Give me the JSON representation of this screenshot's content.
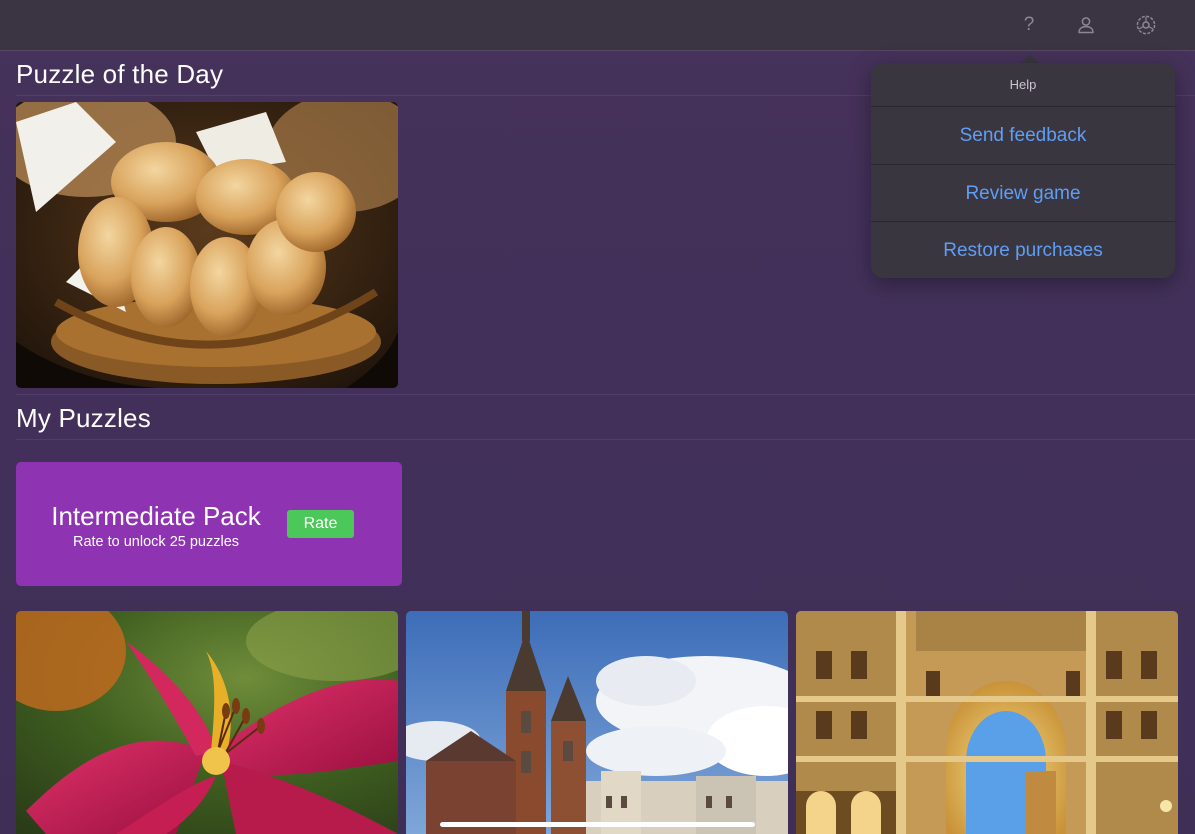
{
  "toolbar": {
    "help_glyph": "?",
    "icons": [
      "help-icon",
      "person-icon",
      "gear-icon"
    ]
  },
  "sections": {
    "daily_title": "Puzzle of the Day",
    "mine_title": "My Puzzles"
  },
  "daily_puzzle": {
    "image": "bread-basket-photo"
  },
  "pack": {
    "title": "Intermediate Pack",
    "subtitle": "Rate to unlock 25 puzzles",
    "button_label": "Rate",
    "color": "#8e33b2",
    "button_color": "#4cc85a"
  },
  "puzzles": [
    {
      "image": "lily-flower-photo"
    },
    {
      "image": "church-towers-photo"
    },
    {
      "image": "arcade-building-photo"
    }
  ],
  "help_popover": {
    "header": "Help",
    "items": [
      "Send feedback",
      "Review game",
      "Restore purchases"
    ],
    "item_color": "#5e9ef5"
  }
}
